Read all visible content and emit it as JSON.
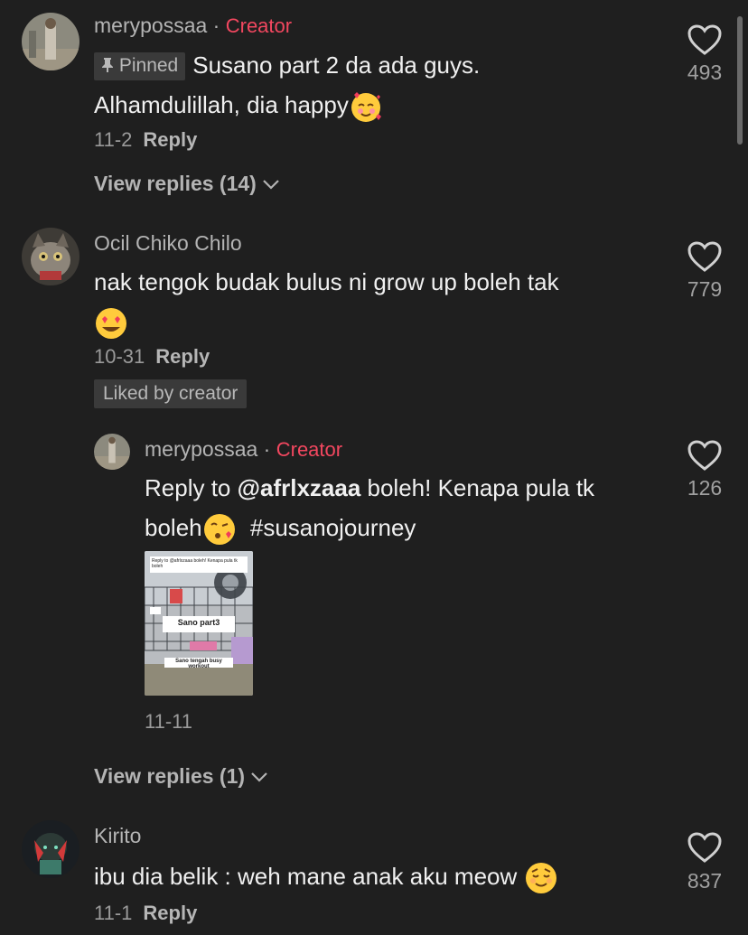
{
  "comments": [
    {
      "user": "merypossaa",
      "creator_label": "Creator",
      "pinned_label": "Pinned",
      "text_line1": "Susano part 2 da ada guys.",
      "text_line2": "Alhamdulillah, dia happy",
      "date": "11-2",
      "reply_label": "Reply",
      "view_replies": "View replies (14)",
      "likes": "493",
      "emoji": "smiling-face-with-hearts"
    },
    {
      "user": "Ocil Chiko Chilo",
      "text_line1": "nak tengok budak bulus ni grow up boleh tak",
      "date": "10-31",
      "reply_label": "Reply",
      "liked_by": "Liked by creator",
      "likes": "779",
      "emoji": "heart-eyes"
    },
    {
      "user": "Kirito",
      "text_line1": "ibu dia belik : weh mane anak aku meow",
      "date": "11-1",
      "reply_label": "Reply",
      "likes": "837",
      "emoji": "relieved-face"
    }
  ],
  "reply": {
    "user": "merypossaa",
    "creator_label": "Creator",
    "prefix": "Reply to",
    "mention": "@afrlxzaaa",
    "text_rest": "boleh! Kenapa pula tk",
    "text_line2_word": "boleh",
    "hashtag": "#susanojourney",
    "date": "11-11",
    "likes": "126",
    "emoji": "face-blowing-kiss",
    "thumbnail": {
      "caption_top": "Reply to @afrlxzaaa boleh! Kenapa pula tk boleh",
      "title": "Sano part3",
      "subtitle": "Sano tengah busy workout"
    }
  },
  "view_replies_2": "View replies (1)",
  "colors": {
    "background": "#1f1f1f",
    "creator": "#f2475f",
    "text": "#f0f0f0",
    "muted": "#9a9a9a"
  }
}
